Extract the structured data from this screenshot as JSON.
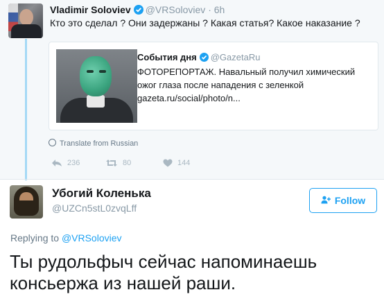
{
  "parent_tweet": {
    "name": "Vladimir Soloviev",
    "handle": "@VRSoloviev",
    "separator": "·",
    "time": "6h",
    "text": "Кто это сделал ? Они задержаны ? Какая статья? Какое наказание ?",
    "quote": {
      "name": "События дня",
      "handle": "@GazetaRu",
      "text": "ФОТОРЕПОРТАЖ. Навальный получил химический ожог глаза после нападения с зеленкой gazeta.ru/social/photo/n..."
    },
    "translate": "Translate from Russian",
    "actions": {
      "replies": "236",
      "retweets": "80",
      "likes": "144"
    }
  },
  "reply_tweet": {
    "name": "Убогий Коленька",
    "handle": "@UZCn5stL0zvqLff",
    "follow_label": "Follow",
    "replying_prefix": "Replying to",
    "replying_to": "@VRSoloviev",
    "text": "Ты рудольфыч сейчас напоминаешь консьержа из нашей раши."
  },
  "colors": {
    "accent": "#1da1f2",
    "thread_line": "#a4d9f6",
    "muted": "#8899a6"
  },
  "icons": [
    "verified-icon",
    "globe-icon",
    "reply-icon",
    "retweet-icon",
    "heart-icon",
    "add-user-icon"
  ]
}
